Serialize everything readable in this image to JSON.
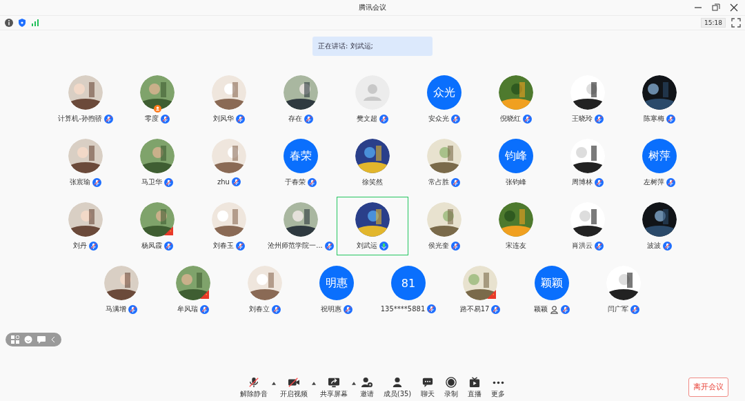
{
  "window": {
    "title": "腾讯会议"
  },
  "status": {
    "time": "15:18"
  },
  "speaking_banner": "正在讲话: 刘武运;",
  "participants": [
    {
      "name": "计算机-孙煦骄",
      "muted": true,
      "speaking": false,
      "host": false,
      "flag": false,
      "person_icon": false,
      "selected": false
    },
    {
      "name": "零度",
      "muted": true,
      "speaking": false,
      "host": true,
      "flag": false,
      "person_icon": false,
      "selected": false
    },
    {
      "name": "刘风华",
      "muted": true,
      "speaking": false,
      "host": false,
      "flag": false,
      "person_icon": false,
      "selected": false
    },
    {
      "name": "存在",
      "muted": true,
      "speaking": false,
      "host": false,
      "flag": false,
      "person_icon": false,
      "selected": false
    },
    {
      "name": "樊文超",
      "avatar": {
        "kind": "default"
      },
      "muted": true,
      "speaking": false,
      "host": false,
      "flag": false,
      "person_icon": false,
      "selected": false
    },
    {
      "name": "安众光",
      "avatar": {
        "kind": "initials",
        "text": "众光"
      },
      "muted": true,
      "speaking": false,
      "host": false,
      "flag": false,
      "person_icon": false,
      "selected": false
    },
    {
      "name": "倪晓红",
      "muted": true,
      "speaking": false,
      "host": false,
      "flag": false,
      "person_icon": false,
      "selected": false
    },
    {
      "name": "王晓玲",
      "muted": true,
      "speaking": false,
      "host": false,
      "flag": false,
      "person_icon": false,
      "selected": false
    },
    {
      "name": "陈寒梅",
      "muted": true,
      "speaking": false,
      "host": false,
      "flag": false,
      "person_icon": false,
      "selected": false
    },
    {
      "name": "张宸瑜",
      "muted": true,
      "speaking": false,
      "host": false,
      "flag": false,
      "person_icon": false,
      "selected": false
    },
    {
      "name": "马卫华",
      "muted": true,
      "speaking": false,
      "host": false,
      "flag": false,
      "person_icon": false,
      "selected": false
    },
    {
      "name": "zhu",
      "muted": true,
      "speaking": false,
      "host": false,
      "flag": false,
      "person_icon": false,
      "selected": false
    },
    {
      "name": "于春荣",
      "avatar": {
        "kind": "initials",
        "text": "春荣"
      },
      "muted": true,
      "speaking": false,
      "host": false,
      "flag": false,
      "person_icon": false,
      "selected": false
    },
    {
      "name": "徐笑然",
      "muted": false,
      "speaking": false,
      "host": false,
      "flag": false,
      "person_icon": false,
      "selected": false
    },
    {
      "name": "常占胜",
      "muted": true,
      "speaking": false,
      "host": false,
      "flag": false,
      "person_icon": false,
      "selected": false
    },
    {
      "name": "张钧峰",
      "avatar": {
        "kind": "initials",
        "text": "钧峰"
      },
      "muted": false,
      "speaking": false,
      "host": false,
      "flag": false,
      "person_icon": false,
      "selected": false
    },
    {
      "name": "周博林",
      "muted": true,
      "speaking": false,
      "host": false,
      "flag": false,
      "person_icon": false,
      "selected": false
    },
    {
      "name": "左树萍",
      "avatar": {
        "kind": "initials",
        "text": "树萍"
      },
      "muted": true,
      "speaking": false,
      "host": false,
      "flag": false,
      "person_icon": false,
      "selected": false
    },
    {
      "name": "刘丹",
      "muted": true,
      "speaking": false,
      "host": false,
      "flag": false,
      "person_icon": false,
      "selected": false
    },
    {
      "name": "杨凤霞",
      "muted": true,
      "speaking": false,
      "host": false,
      "flag": true,
      "person_icon": false,
      "selected": false
    },
    {
      "name": "刘春玉",
      "muted": true,
      "speaking": false,
      "host": false,
      "flag": false,
      "person_icon": false,
      "selected": false
    },
    {
      "name": "沧州师范学院一...",
      "muted": true,
      "speaking": false,
      "host": false,
      "flag": false,
      "person_icon": false,
      "selected": false
    },
    {
      "name": "刘武运",
      "muted": false,
      "speaking": true,
      "host": false,
      "flag": false,
      "person_icon": false,
      "selected": true
    },
    {
      "name": "侯光奎",
      "muted": true,
      "speaking": false,
      "host": false,
      "flag": false,
      "person_icon": false,
      "selected": false
    },
    {
      "name": "宋连友",
      "muted": false,
      "speaking": false,
      "host": false,
      "flag": false,
      "person_icon": false,
      "selected": false
    },
    {
      "name": "肖洪云",
      "muted": true,
      "speaking": false,
      "host": false,
      "flag": false,
      "person_icon": false,
      "selected": false
    },
    {
      "name": "波波",
      "muted": true,
      "speaking": false,
      "host": false,
      "flag": false,
      "person_icon": false,
      "selected": false
    },
    {
      "name": "马满增",
      "muted": true,
      "speaking": false,
      "host": false,
      "flag": false,
      "person_icon": false,
      "selected": false
    },
    {
      "name": "牟风瑞",
      "muted": true,
      "speaking": false,
      "host": false,
      "flag": true,
      "person_icon": false,
      "selected": false
    },
    {
      "name": "刘春立",
      "muted": true,
      "speaking": false,
      "host": false,
      "flag": false,
      "person_icon": false,
      "selected": false
    },
    {
      "name": "祝明惠",
      "avatar": {
        "kind": "initials",
        "text": "明惠"
      },
      "muted": true,
      "speaking": false,
      "host": false,
      "flag": false,
      "person_icon": false,
      "selected": false
    },
    {
      "name": "135****5881",
      "avatar": {
        "kind": "initials",
        "text": "81"
      },
      "muted": true,
      "speaking": false,
      "host": false,
      "flag": false,
      "person_icon": false,
      "selected": false
    },
    {
      "name": "路不易17",
      "muted": true,
      "speaking": false,
      "host": false,
      "flag": true,
      "person_icon": false,
      "selected": false
    },
    {
      "name": "颖颖",
      "avatar": {
        "kind": "initials",
        "text": "颖颖"
      },
      "muted": true,
      "speaking": false,
      "host": false,
      "flag": false,
      "person_icon": true,
      "selected": false
    },
    {
      "name": "闫广军",
      "muted": true,
      "speaking": false,
      "host": false,
      "flag": false,
      "person_icon": false,
      "selected": false
    }
  ],
  "toolbar": [
    {
      "label": "解除静音",
      "caret": true
    },
    {
      "label": "开启视频",
      "caret": true
    },
    {
      "label": "共享屏幕",
      "caret": true
    },
    {
      "label": "邀请",
      "caret": false
    },
    {
      "label": "成员(35)",
      "caret": false
    },
    {
      "label": "聊天",
      "caret": false
    },
    {
      "label": "录制",
      "caret": false
    },
    {
      "label": "直播",
      "caret": false
    },
    {
      "label": "更多",
      "caret": false
    }
  ],
  "leave_button": "离开会议"
}
